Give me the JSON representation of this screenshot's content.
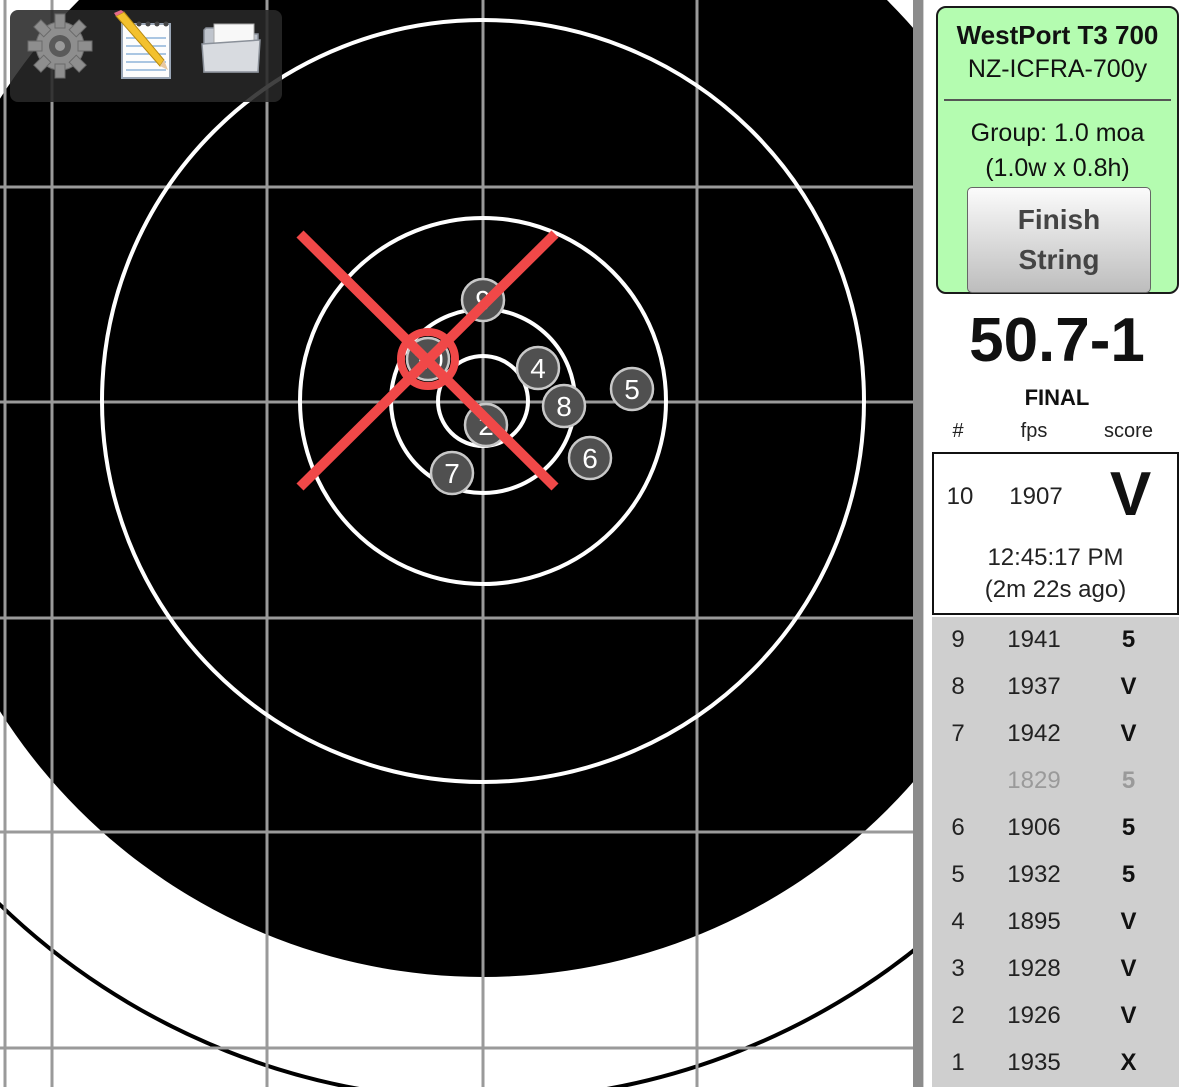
{
  "toolbar": {
    "icons": [
      "gear-icon",
      "notepad-icon",
      "folder-icon"
    ]
  },
  "colors": {
    "target_black": "#000000",
    "ring_white": "#ffffff",
    "grid": "#9a9a9a",
    "x_marker": "#f04848",
    "shot_marker": "#505050",
    "card_green": "#b4fcb0"
  },
  "target_shots": [
    "10",
    "9",
    "4",
    "8",
    "5",
    "6",
    "7",
    "2"
  ],
  "info": {
    "rifle": "WestPort T3 700",
    "target": "NZ-ICFRA-700y",
    "group_size": "Group: 1.0 moa",
    "group_dims": "(1.0w x 0.8h)",
    "finish_line1": "Finish",
    "finish_line2": "String"
  },
  "total_score": "50.7-1",
  "status": "FINAL",
  "columns": {
    "num": "#",
    "fps": "fps",
    "score": "score"
  },
  "latest": {
    "num": "10",
    "fps": "1907",
    "score": "V",
    "time": "12:45:17 PM",
    "ago": "(2m 22s ago)"
  },
  "shots": [
    {
      "num": "9",
      "fps": "1941",
      "score": "5"
    },
    {
      "num": "8",
      "fps": "1937",
      "score": "V"
    },
    {
      "num": "7",
      "fps": "1942",
      "score": "V"
    },
    {
      "num": "",
      "fps": "1829",
      "score": "5",
      "sighter": true
    },
    {
      "num": "6",
      "fps": "1906",
      "score": "5"
    },
    {
      "num": "5",
      "fps": "1932",
      "score": "5"
    },
    {
      "num": "4",
      "fps": "1895",
      "score": "V"
    },
    {
      "num": "3",
      "fps": "1928",
      "score": "V"
    },
    {
      "num": "2",
      "fps": "1926",
      "score": "V"
    },
    {
      "num": "1",
      "fps": "1935",
      "score": "X"
    }
  ]
}
